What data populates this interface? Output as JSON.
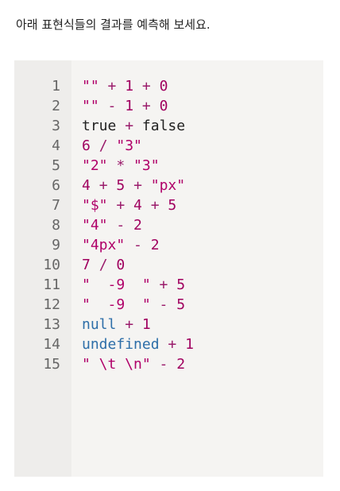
{
  "intro_text": "아래 표현식들의 결과를 예측해 보세요.",
  "colors": {
    "string": "#b00069",
    "number": "#a0005f",
    "operator": "#9a1b6b",
    "keyword": "#2d6ea8",
    "plain": "#222222"
  },
  "code": {
    "lines": [
      {
        "number": "1",
        "tokens": [
          {
            "t": "\"\"",
            "k": "string"
          },
          {
            "t": " ",
            "k": "plain"
          },
          {
            "t": "+",
            "k": "op"
          },
          {
            "t": " ",
            "k": "plain"
          },
          {
            "t": "1",
            "k": "number"
          },
          {
            "t": " ",
            "k": "plain"
          },
          {
            "t": "+",
            "k": "op"
          },
          {
            "t": " ",
            "k": "plain"
          },
          {
            "t": "0",
            "k": "number"
          }
        ]
      },
      {
        "number": "2",
        "tokens": [
          {
            "t": "\"\"",
            "k": "string"
          },
          {
            "t": " ",
            "k": "plain"
          },
          {
            "t": "-",
            "k": "op"
          },
          {
            "t": " ",
            "k": "plain"
          },
          {
            "t": "1",
            "k": "number"
          },
          {
            "t": " ",
            "k": "plain"
          },
          {
            "t": "+",
            "k": "op"
          },
          {
            "t": " ",
            "k": "plain"
          },
          {
            "t": "0",
            "k": "number"
          }
        ]
      },
      {
        "number": "3",
        "tokens": [
          {
            "t": "true",
            "k": "plain"
          },
          {
            "t": " ",
            "k": "plain"
          },
          {
            "t": "+",
            "k": "op"
          },
          {
            "t": " ",
            "k": "plain"
          },
          {
            "t": "false",
            "k": "plain"
          }
        ]
      },
      {
        "number": "4",
        "tokens": [
          {
            "t": "6",
            "k": "number"
          },
          {
            "t": " ",
            "k": "plain"
          },
          {
            "t": "/",
            "k": "op"
          },
          {
            "t": " ",
            "k": "plain"
          },
          {
            "t": "\"3\"",
            "k": "string"
          }
        ]
      },
      {
        "number": "5",
        "tokens": [
          {
            "t": "\"2\"",
            "k": "string"
          },
          {
            "t": " ",
            "k": "plain"
          },
          {
            "t": "*",
            "k": "op"
          },
          {
            "t": " ",
            "k": "plain"
          },
          {
            "t": "\"3\"",
            "k": "string"
          }
        ]
      },
      {
        "number": "6",
        "tokens": [
          {
            "t": "4",
            "k": "number"
          },
          {
            "t": " ",
            "k": "plain"
          },
          {
            "t": "+",
            "k": "op"
          },
          {
            "t": " ",
            "k": "plain"
          },
          {
            "t": "5",
            "k": "number"
          },
          {
            "t": " ",
            "k": "plain"
          },
          {
            "t": "+",
            "k": "op"
          },
          {
            "t": " ",
            "k": "plain"
          },
          {
            "t": "\"px\"",
            "k": "string"
          }
        ]
      },
      {
        "number": "7",
        "tokens": [
          {
            "t": "\"$\"",
            "k": "string"
          },
          {
            "t": " ",
            "k": "plain"
          },
          {
            "t": "+",
            "k": "op"
          },
          {
            "t": " ",
            "k": "plain"
          },
          {
            "t": "4",
            "k": "number"
          },
          {
            "t": " ",
            "k": "plain"
          },
          {
            "t": "+",
            "k": "op"
          },
          {
            "t": " ",
            "k": "plain"
          },
          {
            "t": "5",
            "k": "number"
          }
        ]
      },
      {
        "number": "8",
        "tokens": [
          {
            "t": "\"4\"",
            "k": "string"
          },
          {
            "t": " ",
            "k": "plain"
          },
          {
            "t": "-",
            "k": "op"
          },
          {
            "t": " ",
            "k": "plain"
          },
          {
            "t": "2",
            "k": "number"
          }
        ]
      },
      {
        "number": "9",
        "tokens": [
          {
            "t": "\"4px\"",
            "k": "string"
          },
          {
            "t": " ",
            "k": "plain"
          },
          {
            "t": "-",
            "k": "op"
          },
          {
            "t": " ",
            "k": "plain"
          },
          {
            "t": "2",
            "k": "number"
          }
        ]
      },
      {
        "number": "10",
        "tokens": [
          {
            "t": "7",
            "k": "number"
          },
          {
            "t": " ",
            "k": "plain"
          },
          {
            "t": "/",
            "k": "op"
          },
          {
            "t": " ",
            "k": "plain"
          },
          {
            "t": "0",
            "k": "number"
          }
        ]
      },
      {
        "number": "11",
        "tokens": [
          {
            "t": "\"  -9  \"",
            "k": "string"
          },
          {
            "t": " ",
            "k": "plain"
          },
          {
            "t": "+",
            "k": "op"
          },
          {
            "t": " ",
            "k": "plain"
          },
          {
            "t": "5",
            "k": "number"
          }
        ]
      },
      {
        "number": "12",
        "tokens": [
          {
            "t": "\"  -9  \"",
            "k": "string"
          },
          {
            "t": " ",
            "k": "plain"
          },
          {
            "t": "-",
            "k": "op"
          },
          {
            "t": " ",
            "k": "plain"
          },
          {
            "t": "5",
            "k": "number"
          }
        ]
      },
      {
        "number": "13",
        "tokens": [
          {
            "t": "null",
            "k": "keyword"
          },
          {
            "t": " ",
            "k": "plain"
          },
          {
            "t": "+",
            "k": "op"
          },
          {
            "t": " ",
            "k": "plain"
          },
          {
            "t": "1",
            "k": "number"
          }
        ]
      },
      {
        "number": "14",
        "tokens": [
          {
            "t": "undefined",
            "k": "keyword"
          },
          {
            "t": " ",
            "k": "plain"
          },
          {
            "t": "+",
            "k": "op"
          },
          {
            "t": " ",
            "k": "plain"
          },
          {
            "t": "1",
            "k": "number"
          }
        ]
      },
      {
        "number": "15",
        "tokens": [
          {
            "t": "\" \\t \\n\"",
            "k": "string"
          },
          {
            "t": " ",
            "k": "plain"
          },
          {
            "t": "-",
            "k": "op"
          },
          {
            "t": " ",
            "k": "plain"
          },
          {
            "t": "2",
            "k": "number"
          }
        ]
      }
    ]
  }
}
